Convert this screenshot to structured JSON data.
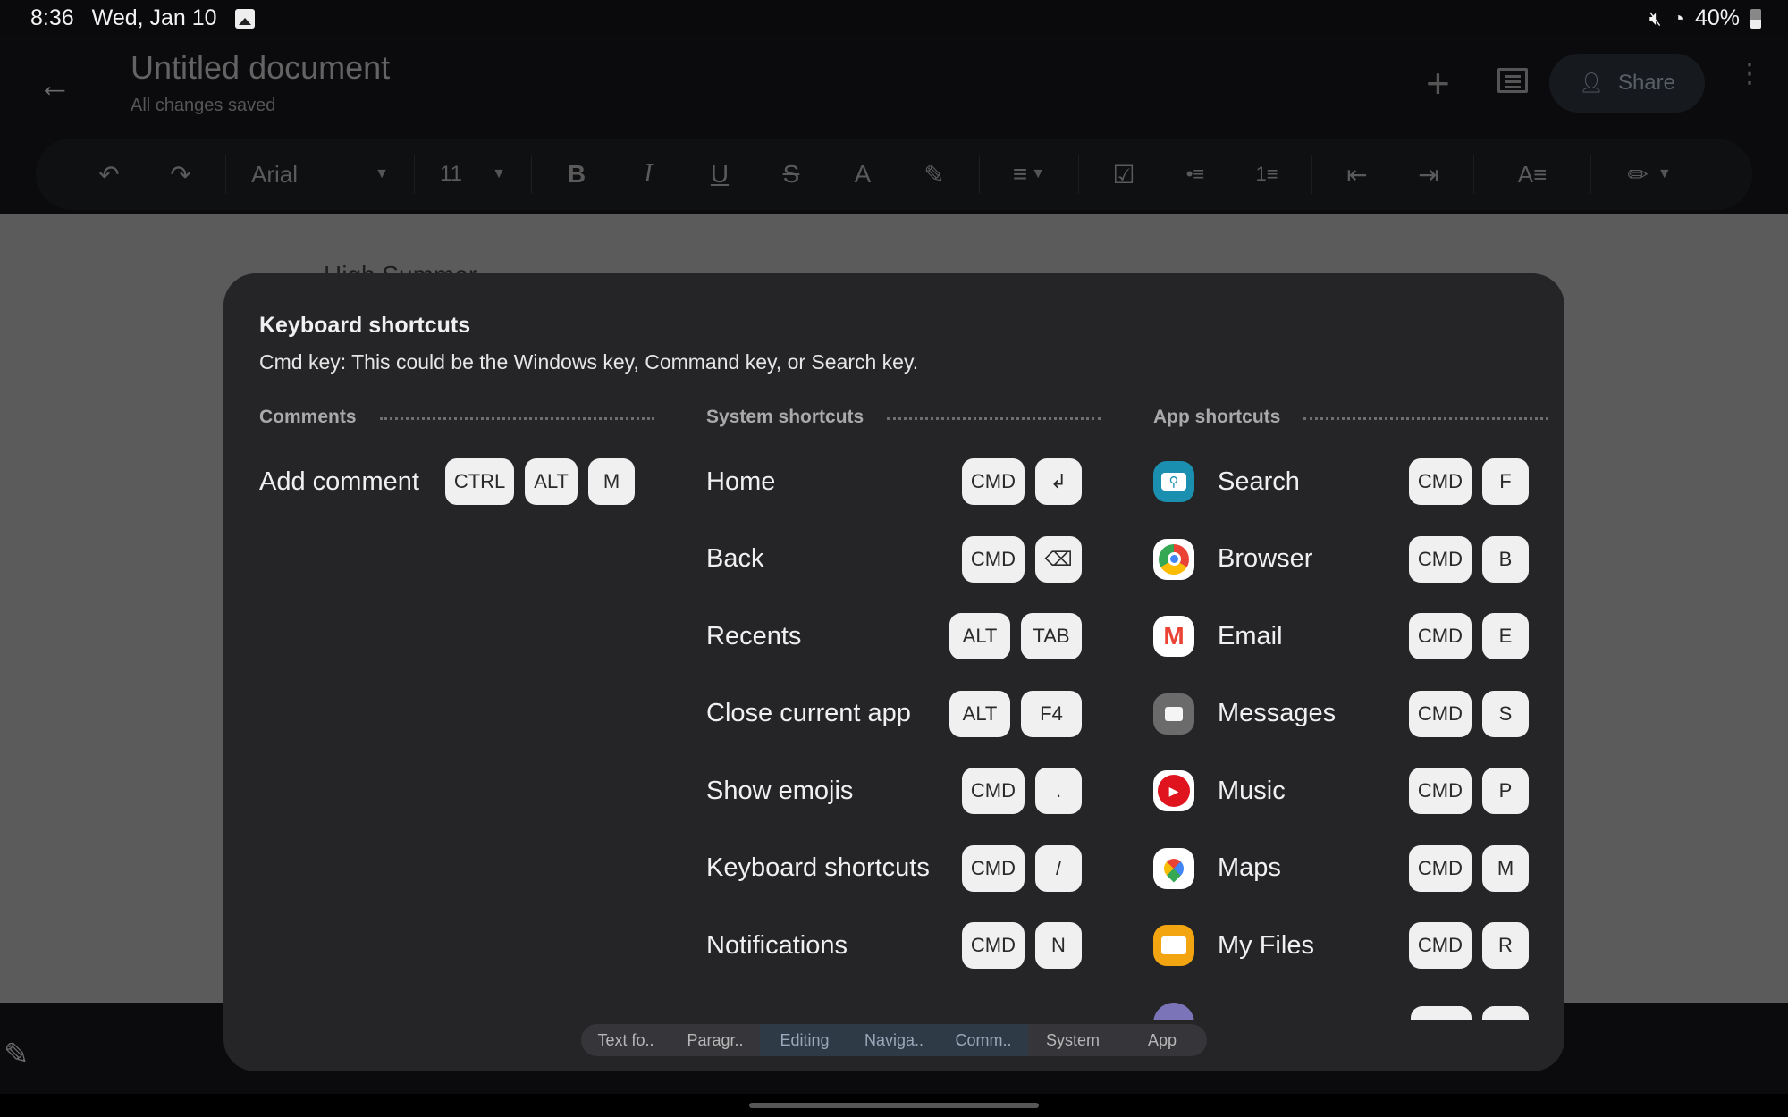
{
  "status_bar": {
    "time": "8:36",
    "date": "Wed, Jan 10",
    "battery": "40%",
    "icons": [
      "gallery-icon",
      "mute-icon",
      "wifi-icon",
      "battery-icon"
    ]
  },
  "header": {
    "back_icon": "←",
    "title": "Untitled document",
    "status": "All changes saved",
    "add_icon": "+",
    "comment_icon": "comment-icon",
    "share_label": "Share",
    "share_icon": "⭘",
    "more_icon": "⋮"
  },
  "toolbar": {
    "undo": "↶",
    "redo": "↷",
    "font": "Arial",
    "font_size": "11",
    "bold": "B",
    "italic": "I",
    "underline": "U",
    "strikethrough": "S",
    "text_color": "A",
    "highlight": "✎",
    "align": "≡",
    "checklist": "☑",
    "bullets": "•≡",
    "numbered": "1≡",
    "indent_decrease": "⇤",
    "indent_increase": "⇥",
    "text_style": "A≡",
    "edit_mode": "✏"
  },
  "document": {
    "visible_text": "High Summer"
  },
  "dialog": {
    "title": "Keyboard shortcuts",
    "subtitle": "Cmd key: This could be the Windows key, Command key, or Search key.",
    "columns": [
      {
        "heading": "Comments",
        "rows": [
          {
            "label": "Add comment",
            "keys": [
              "CTRL",
              "ALT",
              "M"
            ]
          }
        ]
      },
      {
        "heading": "System shortcuts",
        "rows": [
          {
            "label": "Home",
            "keys": [
              "CMD",
              "↲"
            ]
          },
          {
            "label": "Back",
            "keys": [
              "CMD",
              "⌫"
            ]
          },
          {
            "label": "Recents",
            "keys": [
              "ALT",
              "TAB"
            ]
          },
          {
            "label": "Close current app",
            "keys": [
              "ALT",
              "F4"
            ]
          },
          {
            "label": "Show emojis",
            "keys": [
              "CMD",
              "."
            ]
          },
          {
            "label": "Keyboard shortcuts",
            "keys": [
              "CMD",
              "/"
            ]
          },
          {
            "label": "Notifications",
            "keys": [
              "CMD",
              "N"
            ]
          }
        ]
      },
      {
        "heading": "App shortcuts",
        "rows": [
          {
            "label": "Search",
            "icon": "search-app-icon",
            "keys": [
              "CMD",
              "F"
            ]
          },
          {
            "label": "Browser",
            "icon": "chrome-icon",
            "keys": [
              "CMD",
              "B"
            ]
          },
          {
            "label": "Email",
            "icon": "gmail-icon",
            "keys": [
              "CMD",
              "E"
            ]
          },
          {
            "label": "Messages",
            "icon": "messages-icon",
            "keys": [
              "CMD",
              "S"
            ]
          },
          {
            "label": "Music",
            "icon": "youtube-music-icon",
            "keys": [
              "CMD",
              "P"
            ]
          },
          {
            "label": "Maps",
            "icon": "google-maps-icon",
            "keys": [
              "CMD",
              "M"
            ]
          },
          {
            "label": "My Files",
            "icon": "my-files-icon",
            "keys": [
              "CMD",
              "R"
            ]
          }
        ]
      }
    ],
    "tabs": [
      "Text fo..",
      "Paragr..",
      "Editing",
      "Naviga..",
      "Comm..",
      "System",
      "App"
    ],
    "highlighted_tabs": [
      "Editing",
      "Naviga..",
      "Comm.."
    ]
  },
  "colors": {
    "dialog_bg": "#252528",
    "key_bg": "#f0f0f0",
    "search_app": "#1b8fb0",
    "messages_app": "#6b6b6b",
    "music_app": "#e0141e",
    "files_app": "#f2a511"
  }
}
